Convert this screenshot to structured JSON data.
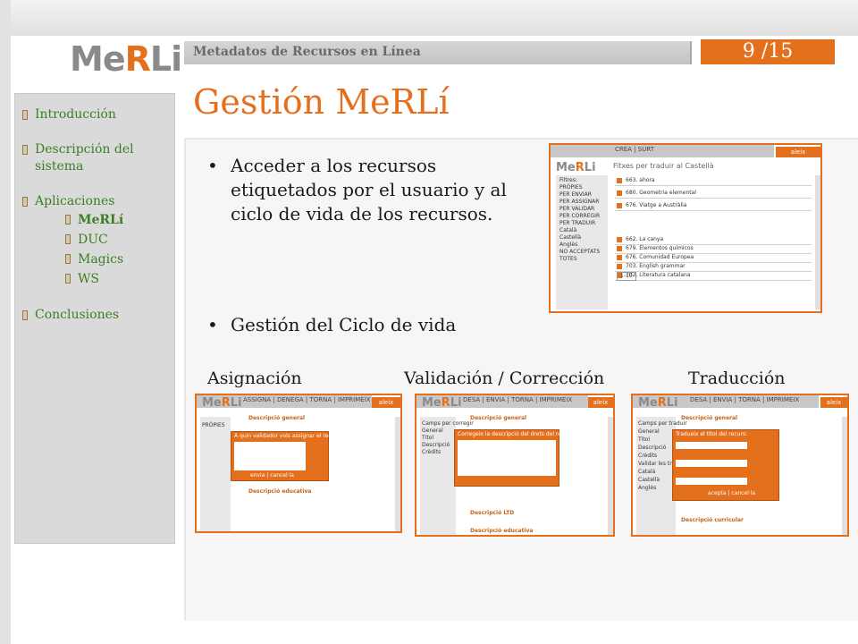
{
  "header": {
    "logo": {
      "part1": "Me",
      "part2": "R",
      "part3": "Li"
    },
    "title": "Metadatos de Recursos en Línea",
    "page": "9 /15"
  },
  "sidebar": {
    "items": [
      {
        "label": "Introducción"
      },
      {
        "label": "Descripción del sistema"
      },
      {
        "label": "Aplicaciones"
      },
      {
        "label": "Conclusiones"
      }
    ],
    "subitems": [
      {
        "label": "MeRLí"
      },
      {
        "label": "DUC"
      },
      {
        "label": "Magics"
      },
      {
        "label": "WS"
      }
    ]
  },
  "main": {
    "heading": "Gestión MeRLí",
    "bullet1": "Acceder a los recursos etiquetados por el usuario y al ciclo de vida de los recursos.",
    "bullet2": "Gestión del Ciclo de vida",
    "labels": {
      "assign": "Asignación",
      "validate": "Validación / Corrección",
      "translate": "Traducción"
    }
  },
  "screens": {
    "main": {
      "menu": "CREA | SURT",
      "user": "aleix",
      "title": "Fitxes per traduir al Castellà",
      "filters": [
        "Filtres:",
        "PRÒPIES",
        "PER ENVIAR",
        "PER ASSIGNAR",
        "PER VALIDAR",
        "PER CORREGIR",
        "PER TRADUIR",
        "Català",
        "Castellà",
        "Anglès",
        "NO ACCEPTATS",
        "TOTES"
      ],
      "rows": [
        "663. ahora",
        "680. Geometria elemental",
        "676. Viatge a Austràlia",
        "662. La canya",
        "679. Elementos químicos",
        "676. Comunidad Europea",
        "703. English grammar",
        "702. Literatura catalana"
      ],
      "pager": "1-10"
    },
    "assign": {
      "menu": "ASSIGNA | DENEGA | TORNA | IMPRIMEIX",
      "user": "aleix",
      "tab": "PRÒPIES",
      "section1": "Descripció general",
      "dialog_title": "A quin validador vols assignar el recurs?",
      "section2": "Descripció educativa",
      "buttons": "envia | cancel·la"
    },
    "validate": {
      "menu": "DESA | ENVIA | TORNA | IMPRIMEIX",
      "user": "aleix",
      "side": [
        "Camps per corregir",
        "General",
        "Títol",
        "Descripció",
        "Crèdits"
      ],
      "section1": "Descripció general",
      "dialog_title": "Corregeix la descripció del drets del recurs:",
      "section2": "Descripció LTD",
      "section3": "Descripció educativa"
    },
    "translate": {
      "menu": "DESA | ENVIA | TORNA | IMPRIMEIX",
      "user": "aleix",
      "side": [
        "Camps per traduir",
        "General",
        "Títol",
        "Descripció",
        "Crèdits",
        "Validar les traduccions",
        "Català",
        "Castellà",
        "Anglès"
      ],
      "section1": "Descripció general",
      "dialog_title": "Tradueix el títol del recurs:",
      "buttons": "acepta | cancel·la",
      "section2": "Descripció curricular"
    }
  }
}
